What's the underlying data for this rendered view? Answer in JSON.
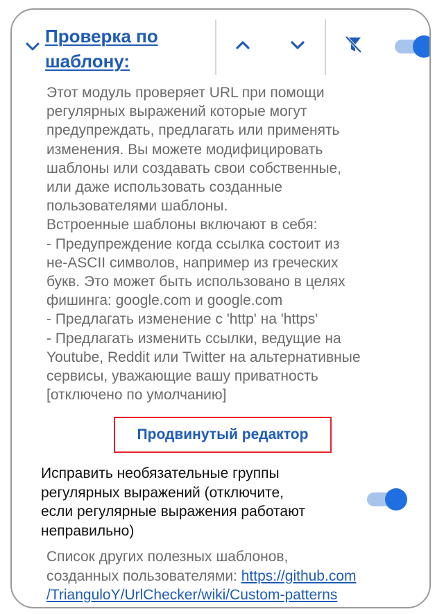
{
  "module": {
    "title": "Проверка по шаблону:",
    "enabled": true,
    "expanded": true
  },
  "toolbar": {
    "expand_icon": "chevron-down-icon",
    "move_up_icon": "chevron-up-icon",
    "move_down_icon": "chevron-down-icon",
    "filter_icon": "filter-off-icon"
  },
  "description": "Этот модуль проверяет URL при помощи\nрегулярных выражений которые могут\nпредупреждать, предлагать или применять\nизменения. Вы можете модифицировать\nшаблоны или создавать свои собственные,\nили даже использовать созданные\nпользователями шаблоны.\nВстроенные шаблоны включают в себя:\n- Предупреждение когда ссылка состоит из\nне-ASCII символов, например из греческих\nбукв. Это может быть использовано в целях\nфишинга: googlе.com и google.com\n- Предлагать изменение с 'http' на 'https'\n- Предлагать изменить ссылки, ведущие на\nYoutube, Reddit или Twitter на альтернативные\nсервисы, уважающие вашу приватность\n[отключено по умолчанию]",
  "advanced_editor_label": "Продвинутый редактор",
  "fix_optional_groups": {
    "label": "Исправить необязательные группы\nрегулярных выражений (отключите,\nесли регулярные выражения работают\nнеправильно)",
    "enabled": true
  },
  "footer": {
    "text": "Список других полезных шаблонов,\nсозданных пользователями: ",
    "link_text": "https://github.com\n/TrianguloY/UrlChecker/wiki/Custom-patterns"
  },
  "colors": {
    "accent": "#1f6fe0",
    "link": "#1e5bb5",
    "highlight_border": "#e8202a",
    "muted_text": "#6b6b6b"
  }
}
